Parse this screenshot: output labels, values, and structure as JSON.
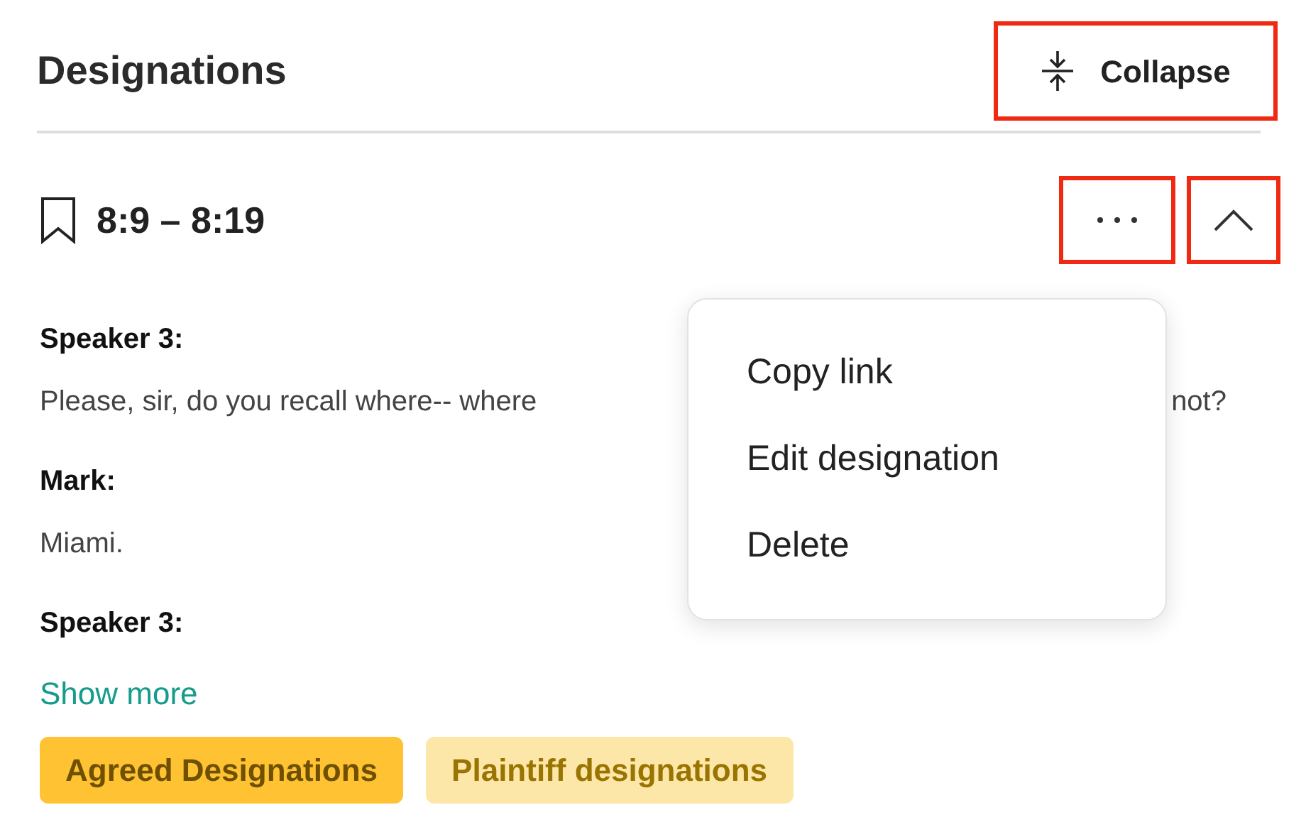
{
  "header": {
    "title": "Designations",
    "collapse_button": {
      "label": "Collapse",
      "highlighted": true
    }
  },
  "designation": {
    "range": "8:9 – 8:19",
    "more_button": {
      "highlighted": true
    },
    "chevron_button": {
      "highlighted": true
    },
    "transcript": [
      {
        "speaker": "Speaker 3:",
        "text": "Please, sir, do you recall where-- where",
        "text_end": "not?"
      },
      {
        "speaker": "Mark:",
        "text": "Miami."
      },
      {
        "speaker": "Speaker 3:"
      }
    ],
    "show_more": "Show more",
    "tags": [
      {
        "label": "Agreed Designations",
        "color": "#ffc233"
      },
      {
        "label": "Plaintiff designations",
        "color": "#fde7a8"
      }
    ]
  },
  "menu": {
    "items": [
      "Copy link",
      "Edit designation",
      "Delete"
    ]
  }
}
